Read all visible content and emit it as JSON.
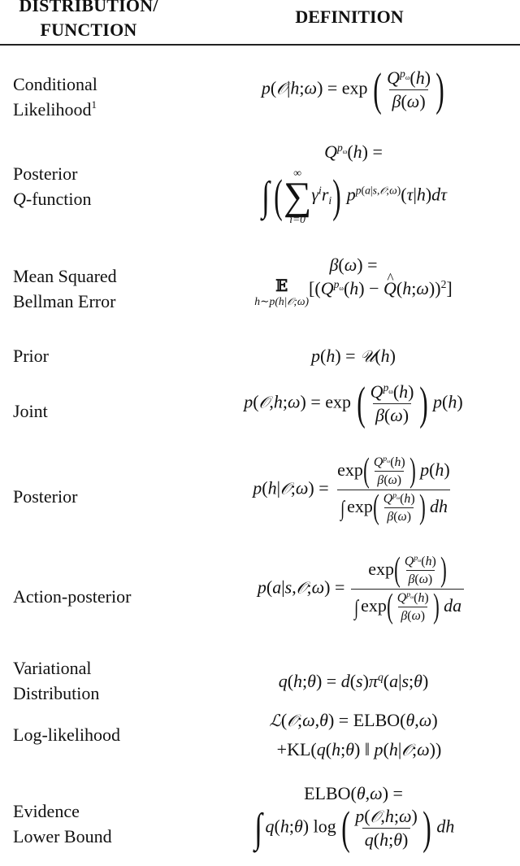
{
  "header": {
    "left_line1": "DISTRIBUTION/",
    "left_line2": "FUNCTION",
    "right": "DEFINITION"
  },
  "rows": [
    {
      "label_lines": [
        "Conditional",
        "Likelihood"
      ],
      "footnote": "1",
      "definition": "p(O|h;ω) = exp( Q^{p_ω}(h) / β(ω) )"
    },
    {
      "label_lines": [
        "Posterior",
        "Q-function"
      ],
      "definition": "Q^{p_ω}(h) = ∫ ( Σ_{i=0}^{∞} γ^i r_i ) p^{p(a|s,O;ω)}(τ|h) dτ"
    },
    {
      "label_lines": [
        "Mean Squared",
        "Bellman Error"
      ],
      "definition": "β(ω) = E_{h∼p(h|O;ω)} [ (Q^{p_ω}(h) − Q̂(h;ω))^2 ]"
    },
    {
      "label_lines": [
        "Prior"
      ],
      "definition": "p(h) = U(h)"
    },
    {
      "label_lines": [
        "Joint"
      ],
      "definition": "p(O,h;ω) = exp( Q^{p_ω}(h) / β(ω) ) p(h)"
    },
    {
      "label_lines": [
        "Posterior"
      ],
      "definition": "p(h|O;ω) = exp(Q^{p_ω}(h)/β(ω)) p(h) / ∫ exp(Q^{p_ω}(h)/β(ω)) dh"
    },
    {
      "label_lines": [
        "Action-posterior"
      ],
      "definition": "p(a|s,O;ω) = exp(Q^{p_ω}(h)/β(ω)) / ∫ exp(Q^{p_ω}(h)/β(ω)) da"
    },
    {
      "label_lines": [
        "Variational",
        "Distribution"
      ],
      "definition": "q(h;θ) = d(s) π^q(a|s;θ)"
    },
    {
      "label_lines": [
        "Log-likelihood"
      ],
      "definition": "L(O;ω,θ) = ELBO(θ,ω) + KL(q(h;θ) ‖ p(h|O;ω))"
    },
    {
      "label_lines": [
        "Evidence",
        "Lower Bound"
      ],
      "definition": "ELBO(θ,ω) = ∫ q(h;θ) log( p(O,h;ω) / q(h;θ) ) dh"
    }
  ],
  "sym": {
    "O": "𝒪",
    "U": "𝒰",
    "L": "ℒ",
    "E": "𝔼",
    "omega": "ω",
    "beta": "β",
    "gamma": "γ",
    "theta": "θ",
    "tau": "τ",
    "pi": "π",
    "inf": "∞",
    "exp": "exp",
    "log": "log",
    "ELBO": "ELBO",
    "KL": "KL"
  }
}
